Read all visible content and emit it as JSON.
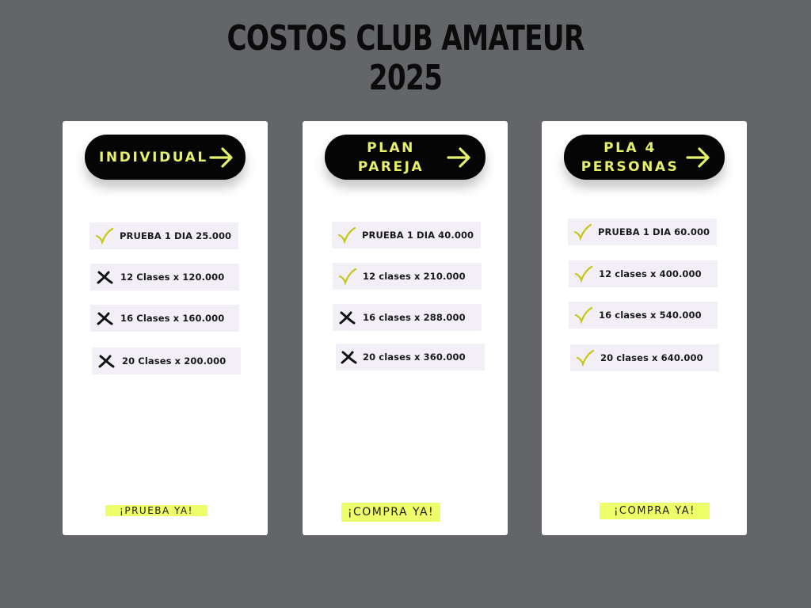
{
  "title": {
    "line1": "COSTOS CLUB AMATEUR",
    "line2": "2025"
  },
  "accent_color": "#e6f06a",
  "cta_color": "#eefe6a",
  "plans": [
    {
      "label": "INDIVIDUAL",
      "icon": "arrow-right-icon",
      "items": [
        {
          "text": "PRUEBA 1 DIA 25.000",
          "mark": "check-icon"
        },
        {
          "text": "12 Clases x 120.000",
          "mark": "cross-icon"
        },
        {
          "text": "16 Clases x 160.000",
          "mark": "cross-icon"
        },
        {
          "text": "20 Clases x 200.000",
          "mark": "cross-icon"
        }
      ],
      "cta": "¡PRUEBA YA!"
    },
    {
      "label_line1": "PLAN",
      "label_line2": "PAREJA",
      "icon": "arrow-right-icon",
      "items": [
        {
          "text": "PRUEBA 1 DIA 40.000",
          "mark": "check-icon"
        },
        {
          "text": "12 clases x 210.000",
          "mark": "check-icon"
        },
        {
          "text": "16 clases x 288.000",
          "mark": "cross-icon"
        },
        {
          "text": "20 clases x 360.000",
          "mark": "cross-icon"
        }
      ],
      "cta": "¡COMPRA YA!"
    },
    {
      "label_line1": "PLA 4",
      "label_line2": "PERSONAS",
      "icon": "arrow-right-icon",
      "items": [
        {
          "text": "PRUEBA 1 DIA 60.000",
          "mark": "check-icon"
        },
        {
          "text": "12 clases x 400.000",
          "mark": "check-icon"
        },
        {
          "text": "16 clases x 540.000",
          "mark": "check-icon"
        },
        {
          "text": "20 clases x 640.000",
          "mark": "check-icon"
        }
      ],
      "cta": "¡COMPRA YA!"
    }
  ]
}
